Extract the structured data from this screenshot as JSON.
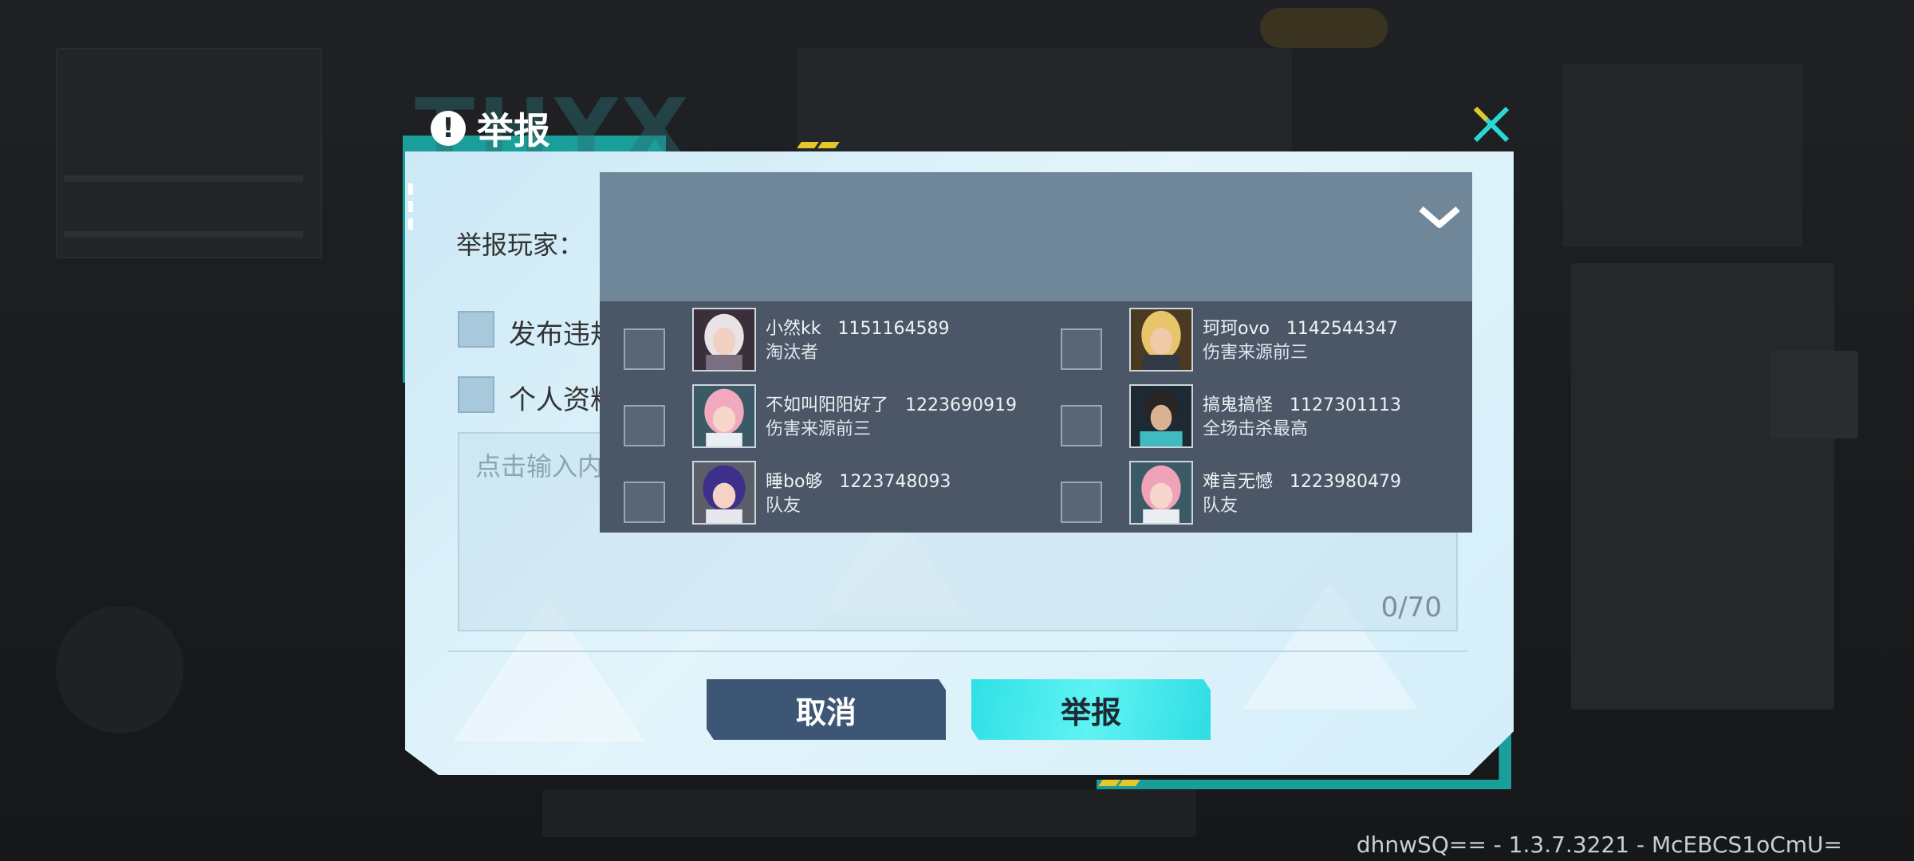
{
  "dialog": {
    "title": "举报",
    "title_watermark": "THYX",
    "report_player_label": "举报玩家：",
    "categories": [
      {
        "label": "发布违规内容"
      },
      {
        "label": "个人资料违规"
      }
    ],
    "text_input": {
      "placeholder": "点击输入内容",
      "counter": "0/70"
    },
    "cancel_label": "取消",
    "report_label": "举报"
  },
  "players": [
    {
      "name": "小然kk",
      "id": "1151164589",
      "tag": "淘汰者"
    },
    {
      "name": "珂珂ovo",
      "id": "1142544347",
      "tag": "伤害来源前三"
    },
    {
      "name": "不如叫阳阳好了",
      "id": "1223690919",
      "tag": "伤害来源前三"
    },
    {
      "name": "搞鬼搞怪",
      "id": "1127301113",
      "tag": "全场击杀最高"
    },
    {
      "name": "睡bo够",
      "id": "1223748093",
      "tag": "队友"
    },
    {
      "name": "难言无憾",
      "id": "1223980479",
      "tag": "队友"
    }
  ],
  "footer": {
    "build": "dhnwSQ== - 1.3.7.3221 - McEBCS1oCmU="
  },
  "colors": {
    "accent_teal": "#1a9e9a",
    "report_button": "#2fe0e6",
    "cancel_button": "#3e5675",
    "dropdown_bg": "#4b5766"
  }
}
